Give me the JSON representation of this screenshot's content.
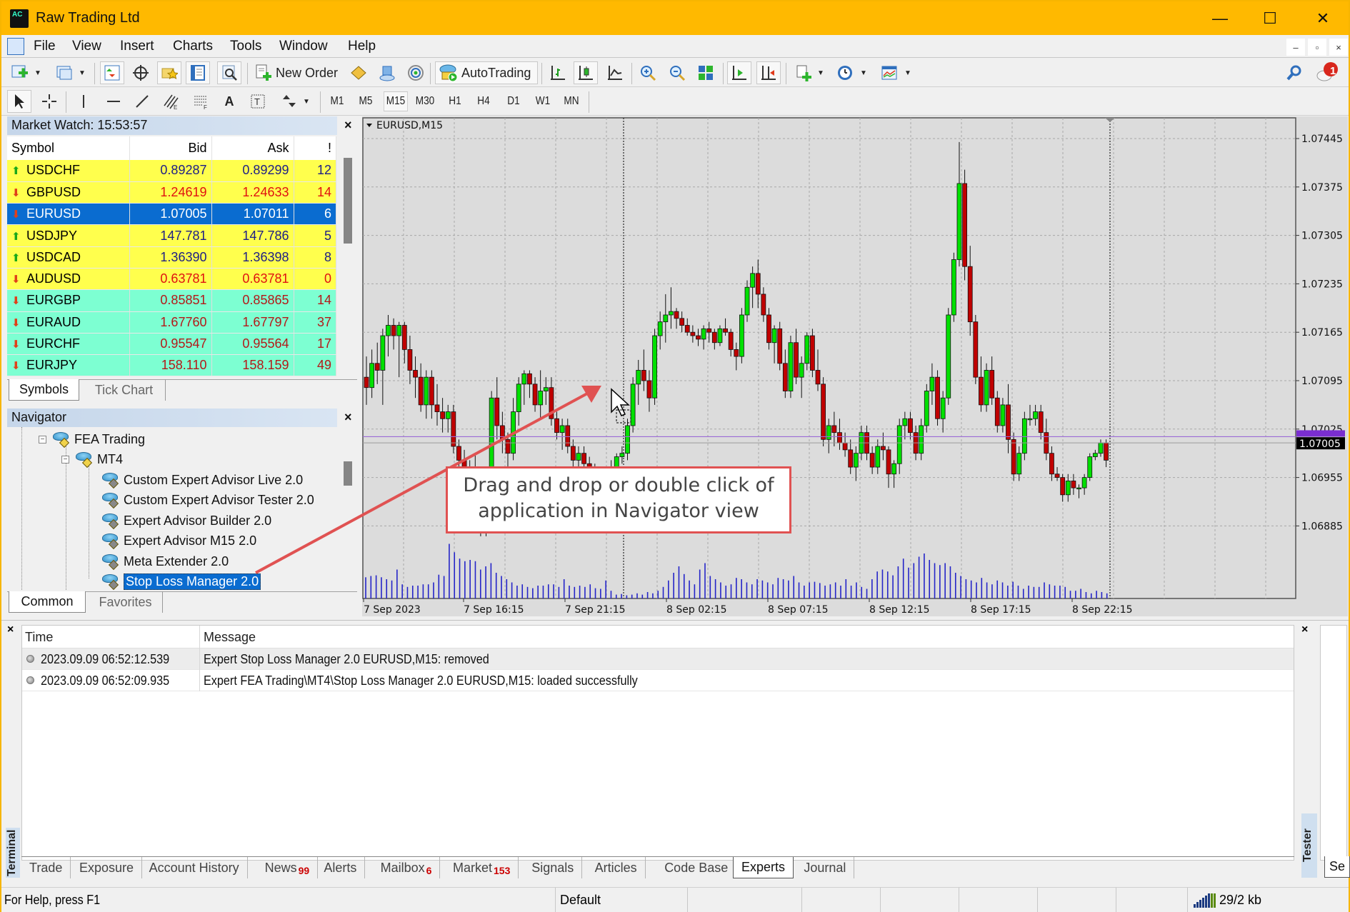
{
  "window": {
    "title": "Raw Trading Ltd",
    "controls": {
      "minimize": "—",
      "maximize": "☐",
      "close": "✕"
    }
  },
  "menu": {
    "items": [
      "File",
      "View",
      "Insert",
      "Charts",
      "Tools",
      "Window",
      "Help"
    ],
    "mdi_controls": {
      "minimize": "–",
      "restore": "▫",
      "close": "×"
    }
  },
  "toolbar": {
    "new_order_label": "New Order",
    "autotrading_label": "AutoTrading",
    "notification_count": "1",
    "timeframes": [
      "M1",
      "M5",
      "M15",
      "M30",
      "H1",
      "H4",
      "D1",
      "W1",
      "MN"
    ],
    "active_timeframe": "M15"
  },
  "market_watch": {
    "title": "Market Watch: 15:53:57",
    "columns": [
      "Symbol",
      "Bid",
      "Ask",
      "!"
    ],
    "rows": [
      {
        "symbol": "USDCHF",
        "bid": "0.89287",
        "ask": "0.89299",
        "spread": "12",
        "dir": "up",
        "group": "yellow"
      },
      {
        "symbol": "GBPUSD",
        "bid": "1.24619",
        "ask": "1.24633",
        "spread": "14",
        "dir": "down",
        "group": "yellow"
      },
      {
        "symbol": "EURUSD",
        "bid": "1.07005",
        "ask": "1.07011",
        "spread": "6",
        "dir": "down",
        "group": "selected"
      },
      {
        "symbol": "USDJPY",
        "bid": "147.781",
        "ask": "147.786",
        "spread": "5",
        "dir": "up",
        "group": "yellow"
      },
      {
        "symbol": "USDCAD",
        "bid": "1.36390",
        "ask": "1.36398",
        "spread": "8",
        "dir": "up",
        "group": "yellow"
      },
      {
        "symbol": "AUDUSD",
        "bid": "0.63781",
        "ask": "0.63781",
        "spread": "0",
        "dir": "down",
        "group": "yellow"
      },
      {
        "symbol": "EURGBP",
        "bid": "0.85851",
        "ask": "0.85865",
        "spread": "14",
        "dir": "down",
        "group": "green"
      },
      {
        "symbol": "EURAUD",
        "bid": "1.67760",
        "ask": "1.67797",
        "spread": "37",
        "dir": "down",
        "group": "green"
      },
      {
        "symbol": "EURCHF",
        "bid": "0.95547",
        "ask": "0.95564",
        "spread": "17",
        "dir": "down",
        "group": "green"
      },
      {
        "symbol": "EURJPY",
        "bid": "158.110",
        "ask": "158.159",
        "spread": "49",
        "dir": "down",
        "group": "green"
      }
    ],
    "tabs": [
      "Symbols",
      "Tick Chart"
    ],
    "active_tab": "Symbols"
  },
  "navigator": {
    "title": "Navigator",
    "tree": [
      {
        "label": "FEA Trading",
        "level": 0,
        "expanded": true
      },
      {
        "label": "MT4",
        "level": 1,
        "expanded": true
      },
      {
        "label": "Custom Expert Advisor Live 2.0",
        "level": 2
      },
      {
        "label": "Custom Expert Advisor Tester 2.0",
        "level": 2
      },
      {
        "label": "Expert Advisor Builder 2.0",
        "level": 2
      },
      {
        "label": "Expert Advisor M15 2.0",
        "level": 2
      },
      {
        "label": "Meta Extender 2.0",
        "level": 2
      },
      {
        "label": "Stop Loss Manager 2.0",
        "level": 2,
        "selected": true
      }
    ],
    "tabs": [
      "Common",
      "Favorites"
    ],
    "active_tab": "Common"
  },
  "callout": {
    "line1": "Drag and drop or double click of",
    "line2": "application in Navigator view",
    "color": "#e05252"
  },
  "chart_data": {
    "type": "candlestick",
    "title": "EURUSD,M15",
    "symbol": "EURUSD",
    "timeframe": "M15",
    "y_ticks": [
      "1.07445",
      "1.07375",
      "1.07305",
      "1.07235",
      "1.07165",
      "1.07095",
      "1.07025",
      "1.06955",
      "1.06885"
    ],
    "ylim": [
      1.0685,
      1.0748
    ],
    "x_ticks": [
      "7 Sep 2023",
      "7 Sep 16:15",
      "7 Sep 21:15",
      "8 Sep 02:15",
      "8 Sep 07:15",
      "8 Sep 12:15",
      "8 Sep 17:15",
      "8 Sep 22:15"
    ],
    "current_bid": "1.07005",
    "current_bid_value": 1.07005,
    "ask_line_value": 1.07014,
    "grid": true,
    "colors": {
      "bull": "#00e000",
      "bear": "#c00000",
      "volume": "#2424c8",
      "bid_line": "#9b6bd6",
      "background": "#dcdcdc"
    },
    "candles_note": "OHLC approximated from chart",
    "candles": [
      [
        1.071,
        1.0713,
        1.0706,
        1.07085
      ],
      [
        1.07085,
        1.0714,
        1.0707,
        1.0712
      ],
      [
        1.0712,
        1.0715,
        1.0709,
        1.0711
      ],
      [
        1.0711,
        1.0717,
        1.0706,
        1.0716
      ],
      [
        1.0716,
        1.0719,
        1.0713,
        1.07175
      ],
      [
        1.07175,
        1.07185,
        1.0714,
        1.0716
      ],
      [
        1.0716,
        1.0718,
        1.071,
        1.07175
      ],
      [
        1.07175,
        1.0718,
        1.0712,
        1.0714
      ],
      [
        1.0714,
        1.0716,
        1.0709,
        1.0711
      ],
      [
        1.0711,
        1.0713,
        1.0707,
        1.071
      ],
      [
        1.071,
        1.0712,
        1.0705,
        1.0706
      ],
      [
        1.0706,
        1.0711,
        1.0704,
        1.071
      ],
      [
        1.071,
        1.0711,
        1.0704,
        1.0706
      ],
      [
        1.0706,
        1.0709,
        1.0703,
        1.0705
      ],
      [
        1.0705,
        1.0707,
        1.0702,
        1.0704
      ],
      [
        1.0704,
        1.0706,
        1.0702,
        1.0705
      ],
      [
        1.0705,
        1.0706,
        1.0699,
        1.07
      ],
      [
        1.07,
        1.0701,
        1.0696,
        1.0698
      ],
      [
        1.0698,
        1.06995,
        1.0693,
        1.0695
      ],
      [
        1.0695,
        1.0698,
        1.0692,
        1.0697
      ],
      [
        1.0697,
        1.0699,
        1.0688,
        1.069
      ],
      [
        1.069,
        1.0692,
        1.0687,
        1.0689
      ],
      [
        1.0689,
        1.0693,
        1.0687,
        1.0692
      ],
      [
        1.0692,
        1.0708,
        1.0691,
        1.0707
      ],
      [
        1.0707,
        1.071,
        1.0701,
        1.0703
      ],
      [
        1.0703,
        1.0705,
        1.0699,
        1.0701
      ],
      [
        1.0701,
        1.0702,
        1.0696,
        1.0699
      ],
      [
        1.0699,
        1.0707,
        1.0698,
        1.0705
      ],
      [
        1.0705,
        1.071,
        1.0703,
        1.0709
      ],
      [
        1.0709,
        1.0711,
        1.0706,
        1.07105
      ],
      [
        1.07105,
        1.0711,
        1.0707,
        1.0709
      ],
      [
        1.0709,
        1.071,
        1.0705,
        1.0706
      ],
      [
        1.0706,
        1.0711,
        1.0704,
        1.0708
      ],
      [
        1.0708,
        1.071,
        1.0706,
        1.07085
      ],
      [
        1.07085,
        1.071,
        1.0703,
        1.0704
      ],
      [
        1.0704,
        1.0705,
        1.0701,
        1.0702
      ],
      [
        1.0702,
        1.0704,
        1.06995,
        1.0703
      ],
      [
        1.0703,
        1.0704,
        1.0699,
        1.07
      ],
      [
        1.07,
        1.0701,
        1.0696,
        1.0698
      ],
      [
        1.0698,
        1.07,
        1.0696,
        1.0699
      ],
      [
        1.0699,
        1.07,
        1.06965,
        1.06975
      ],
      [
        1.06975,
        1.06985,
        1.0696,
        1.0697
      ],
      [
        1.0697,
        1.06975,
        1.06955,
        1.06965
      ],
      [
        1.06965,
        1.0697,
        1.0695,
        1.0696
      ],
      [
        1.0696,
        1.0697,
        1.0695,
        1.06965
      ],
      [
        1.06965,
        1.0698,
        1.06955,
        1.0697
      ],
      [
        1.0697,
        1.0699,
        1.0696,
        1.06985
      ],
      [
        1.06985,
        1.07,
        1.06975,
        1.0699
      ],
      [
        1.0699,
        1.0704,
        1.0698,
        1.0703
      ],
      [
        1.0703,
        1.071,
        1.0702,
        1.0709
      ],
      [
        1.0709,
        1.07125,
        1.0706,
        1.0711
      ],
      [
        1.0711,
        1.0714,
        1.0708,
        1.07095
      ],
      [
        1.07095,
        1.0711,
        1.0705,
        1.0707
      ],
      [
        1.0707,
        1.0717,
        1.0706,
        1.0716
      ],
      [
        1.0716,
        1.07195,
        1.0714,
        1.0718
      ],
      [
        1.0718,
        1.0722,
        1.0715,
        1.0719
      ],
      [
        1.0719,
        1.0723,
        1.0717,
        1.07195
      ],
      [
        1.07195,
        1.072,
        1.0717,
        1.07185
      ],
      [
        1.07185,
        1.07195,
        1.07165,
        1.07175
      ],
      [
        1.07175,
        1.07185,
        1.0716,
        1.07165
      ],
      [
        1.07165,
        1.07175,
        1.0715,
        1.0716
      ],
      [
        1.0716,
        1.0717,
        1.07145,
        1.07155
      ],
      [
        1.07155,
        1.07175,
        1.0714,
        1.0717
      ],
      [
        1.0717,
        1.0718,
        1.0715,
        1.07165
      ],
      [
        1.07165,
        1.0717,
        1.0714,
        1.0715
      ],
      [
        1.0715,
        1.07175,
        1.07145,
        1.0717
      ],
      [
        1.0717,
        1.07185,
        1.0716,
        1.07165
      ],
      [
        1.07165,
        1.0717,
        1.0713,
        1.0714
      ],
      [
        1.0714,
        1.0715,
        1.0711,
        1.0713
      ],
      [
        1.0713,
        1.072,
        1.0712,
        1.0719
      ],
      [
        1.0719,
        1.0724,
        1.0718,
        1.0723
      ],
      [
        1.0723,
        1.0726,
        1.072,
        1.0725
      ],
      [
        1.0725,
        1.0727,
        1.072,
        1.0722
      ],
      [
        1.0722,
        1.0723,
        1.0718,
        1.0719
      ],
      [
        1.0719,
        1.072,
        1.0714,
        1.0715
      ],
      [
        1.0715,
        1.07175,
        1.0712,
        1.0717
      ],
      [
        1.0717,
        1.0718,
        1.0711,
        1.0712
      ],
      [
        1.0712,
        1.0714,
        1.0707,
        1.0708
      ],
      [
        1.0708,
        1.0716,
        1.0707,
        1.0715
      ],
      [
        1.0715,
        1.0717,
        1.0709,
        1.071
      ],
      [
        1.071,
        1.0713,
        1.0707,
        1.0712
      ],
      [
        1.0712,
        1.07165,
        1.0711,
        1.0716
      ],
      [
        1.0716,
        1.0717,
        1.071,
        1.0711
      ],
      [
        1.0711,
        1.0714,
        1.0708,
        1.0709
      ],
      [
        1.0709,
        1.071,
        1.07,
        1.0701
      ],
      [
        1.0701,
        1.0704,
        1.0699,
        1.0703
      ],
      [
        1.0703,
        1.0705,
        1.07,
        1.0702
      ],
      [
        1.0702,
        1.0704,
        1.06995,
        1.07005
      ],
      [
        1.07005,
        1.0702,
        1.06985,
        1.06995
      ],
      [
        1.06995,
        1.0701,
        1.0696,
        1.0697
      ],
      [
        1.0697,
        1.07,
        1.0695,
        1.0699
      ],
      [
        1.0699,
        1.0703,
        1.0698,
        1.0702
      ],
      [
        1.0702,
        1.0703,
        1.0698,
        1.0699
      ],
      [
        1.0699,
        1.07,
        1.0696,
        1.0697
      ],
      [
        1.0697,
        1.0701,
        1.0696,
        1.07
      ],
      [
        1.07,
        1.0702,
        1.0698,
        1.06995
      ],
      [
        1.06995,
        1.07,
        1.0694,
        1.0696
      ],
      [
        1.0696,
        1.0698,
        1.0694,
        1.06975
      ],
      [
        1.06975,
        1.0704,
        1.0696,
        1.0703
      ],
      [
        1.0703,
        1.0705,
        1.0701,
        1.0704
      ],
      [
        1.0704,
        1.0705,
        1.0701,
        1.0702
      ],
      [
        1.0702,
        1.0703,
        1.0698,
        1.0699
      ],
      [
        1.0699,
        1.0704,
        1.0698,
        1.0703
      ],
      [
        1.0703,
        1.0709,
        1.0702,
        1.0708
      ],
      [
        1.0708,
        1.0712,
        1.0706,
        1.071
      ],
      [
        1.071,
        1.0711,
        1.0703,
        1.0704
      ],
      [
        1.0704,
        1.0708,
        1.0702,
        1.0707
      ],
      [
        1.0707,
        1.072,
        1.0706,
        1.0719
      ],
      [
        1.0719,
        1.0728,
        1.0718,
        1.0727
      ],
      [
        1.0727,
        1.0744,
        1.0726,
        1.0738
      ],
      [
        1.0738,
        1.074,
        1.0724,
        1.0726
      ],
      [
        1.0726,
        1.0729,
        1.0716,
        1.0718
      ],
      [
        1.0718,
        1.0719,
        1.0709,
        1.071
      ],
      [
        1.071,
        1.0713,
        1.0705,
        1.0706
      ],
      [
        1.0706,
        1.0712,
        1.0705,
        1.0711
      ],
      [
        1.0711,
        1.0713,
        1.0706,
        1.0707
      ],
      [
        1.0707,
        1.0708,
        1.0702,
        1.0703
      ],
      [
        1.0703,
        1.0707,
        1.0702,
        1.0706
      ],
      [
        1.0706,
        1.0709,
        1.0699,
        1.0701
      ],
      [
        1.0701,
        1.0702,
        1.0695,
        1.0696
      ],
      [
        1.0696,
        1.07,
        1.0695,
        1.0699
      ],
      [
        1.0699,
        1.0705,
        1.0698,
        1.0704
      ],
      [
        1.0704,
        1.0706,
        1.0703,
        1.0704
      ],
      [
        1.0704,
        1.0706,
        1.0703,
        1.0705
      ],
      [
        1.0705,
        1.0706,
        1.0701,
        1.0702
      ],
      [
        1.0702,
        1.0704,
        1.0698,
        1.0699
      ],
      [
        1.0699,
        1.07,
        1.0695,
        1.0696
      ],
      [
        1.0696,
        1.0697,
        1.0695,
        1.06955
      ],
      [
        1.06955,
        1.0696,
        1.0692,
        1.0693
      ],
      [
        1.0693,
        1.0696,
        1.0692,
        1.0695
      ],
      [
        1.0695,
        1.0696,
        1.0693,
        1.0694
      ],
      [
        1.0694,
        1.06945,
        1.06925,
        1.0694
      ],
      [
        1.0694,
        1.0696,
        1.0693,
        1.06955
      ],
      [
        1.06955,
        1.0699,
        1.0695,
        1.06985
      ],
      [
        1.06985,
        1.06995,
        1.0698,
        1.0699
      ],
      [
        1.0699,
        1.0701,
        1.06985,
        1.07005
      ],
      [
        1.07005,
        1.0701,
        1.0697,
        1.0698
      ]
    ],
    "volumes_note": "relative volume 0-1 approximated",
    "volumes": [
      0.33,
      0.35,
      0.36,
      0.33,
      0.3,
      0.28,
      0.45,
      0.22,
      0.18,
      0.2,
      0.2,
      0.22,
      0.22,
      0.25,
      0.37,
      0.35,
      0.85,
      0.72,
      0.62,
      0.58,
      0.6,
      0.58,
      0.45,
      0.5,
      0.55,
      0.4,
      0.35,
      0.3,
      0.25,
      0.2,
      0.22,
      0.18,
      0.16,
      0.2,
      0.2,
      0.22,
      0.22,
      0.18,
      0.3,
      0.2,
      0.18,
      0.2,
      0.18,
      0.22,
      0.16,
      0.15,
      0.28,
      0.12,
      0.06,
      0.07,
      0.05,
      0.06,
      0.08,
      0.06,
      0.1,
      0.08,
      0.12,
      0.18,
      0.28,
      0.4,
      0.5,
      0.38,
      0.28,
      0.22,
      0.45,
      0.55,
      0.35,
      0.3,
      0.25,
      0.2,
      0.22,
      0.32,
      0.3,
      0.25,
      0.22,
      0.3,
      0.28,
      0.25,
      0.22,
      0.32,
      0.3,
      0.28,
      0.35,
      0.25,
      0.2,
      0.25,
      0.26,
      0.24,
      0.2,
      0.22,
      0.25,
      0.2,
      0.3,
      0.2,
      0.25,
      0.18,
      0.15,
      0.3,
      0.42,
      0.45,
      0.42,
      0.36,
      0.5,
      0.62,
      0.48,
      0.55,
      0.65,
      0.7,
      0.6,
      0.55,
      0.52,
      0.55,
      0.5,
      0.4,
      0.35,
      0.3,
      0.28,
      0.25,
      0.32,
      0.25,
      0.22,
      0.28,
      0.25,
      0.2,
      0.26,
      0.2,
      0.15,
      0.2,
      0.18,
      0.18,
      0.25,
      0.22,
      0.2,
      0.2,
      0.18,
      0.12,
      0.12,
      0.15,
      0.1,
      0.08,
      0.12,
      0.1,
      0.08
    ]
  },
  "terminal": {
    "label": "Terminal",
    "columns": [
      "Time",
      "Message"
    ],
    "rows": [
      {
        "time": "2023.09.09 06:52:12.539",
        "message": "Expert Stop Loss Manager 2.0 EURUSD,M15: removed"
      },
      {
        "time": "2023.09.09 06:52:09.935",
        "message": "Expert FEA Trading\\MT4\\Stop Loss Manager 2.0 EURUSD,M15: loaded successfully"
      }
    ],
    "tabs": [
      {
        "label": "Trade"
      },
      {
        "label": "Exposure"
      },
      {
        "label": "Account History"
      },
      {
        "label": "News",
        "badge": "99"
      },
      {
        "label": "Alerts"
      },
      {
        "label": "Mailbox",
        "badge": "6"
      },
      {
        "label": "Market",
        "badge": "153"
      },
      {
        "label": "Signals"
      },
      {
        "label": "Articles"
      },
      {
        "label": "Code Base"
      },
      {
        "label": "Experts",
        "active": true
      },
      {
        "label": "Journal"
      }
    ]
  },
  "tester": {
    "label": "Tester",
    "tab_partial": "Se"
  },
  "statusbar": {
    "help": "For Help, press F1",
    "profile": "Default",
    "traffic": "29/2 kb"
  }
}
